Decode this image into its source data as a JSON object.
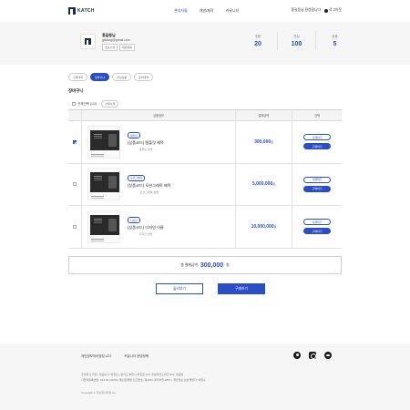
{
  "header": {
    "logo_text": "KATCH",
    "nav": [
      "관리자몰",
      "개발/제작",
      "커뮤니티"
    ],
    "nav_active_index": 0,
    "user_greeting": "홍길동님 환영합니다",
    "logout_label": "로그아웃"
  },
  "profile": {
    "name": "홍길동님",
    "email": "gildong@gmail.com",
    "buttons": [
      "정보수정",
      "회원탈퇴"
    ],
    "stats": [
      {
        "label": "주문",
        "value": "20"
      },
      {
        "label": "관심",
        "value": "100"
      },
      {
        "label": "쿠폰",
        "value": "5"
      }
    ]
  },
  "tabs": [
    "구매내역",
    "장바구니",
    "관심상품",
    "문의내역"
  ],
  "active_tab": 1,
  "cart": {
    "title": "장바구니",
    "select_all_label": "전체선택 (1/3)",
    "delete_selected_label": "선택삭제",
    "columns": [
      "상품정보",
      "결제금액",
      "선택"
    ],
    "items": [
      {
        "badge": "템플릿",
        "title": "(상품코드) 템플릿 제목",
        "subtitle": "템플릿 설명",
        "price": "300,000",
        "unit": "원",
        "checked": true,
        "delete_label": "삭제하기",
        "buy_label": "구매하기"
      },
      {
        "badge": "모션그래픽",
        "title": "(상품코드) 모션그래픽 제목",
        "subtitle": "모션그래픽 설명",
        "price": "5,000,000",
        "unit": "원",
        "checked": false,
        "delete_label": "삭제하기",
        "buy_label": "구매하기"
      },
      {
        "badge": "디자인",
        "title": "(상품코드) 디자인 이름",
        "subtitle": "디자인 설명",
        "price": "10,000,000",
        "unit": "원",
        "checked": false,
        "delete_label": "삭제하기",
        "buy_label": "구매하기"
      }
    ],
    "total_count_text": "총 결제금액",
    "total_amount": "300,000",
    "total_unit": "원"
  },
  "actions": {
    "more_label": "둘러보기",
    "buy_label": "구매하기"
  },
  "footer": {
    "links": [
      "개인정보처리방침 v2.0",
      "커뮤니티 운영정책"
    ],
    "icons": [
      "github-icon",
      "instagram-icon",
      "youtube-icon"
    ],
    "info_line1": "주식회사 카찹  |  대표이사: 박철수  |  경기도 부천시 부천로 223, 우성테크노파크 503, 유원호",
    "info_line2": "사업자등록번호: 624-80-00206  |  통신판매업 신고번호: 제2022-경기부천-3867  |  개인정보 보호책임자: 박철수",
    "copyright": "Copyright © 주식회사카찹 Co."
  },
  "colors": {
    "accent": "#2b4dc8",
    "brand_dark": "#1b2a4e"
  }
}
